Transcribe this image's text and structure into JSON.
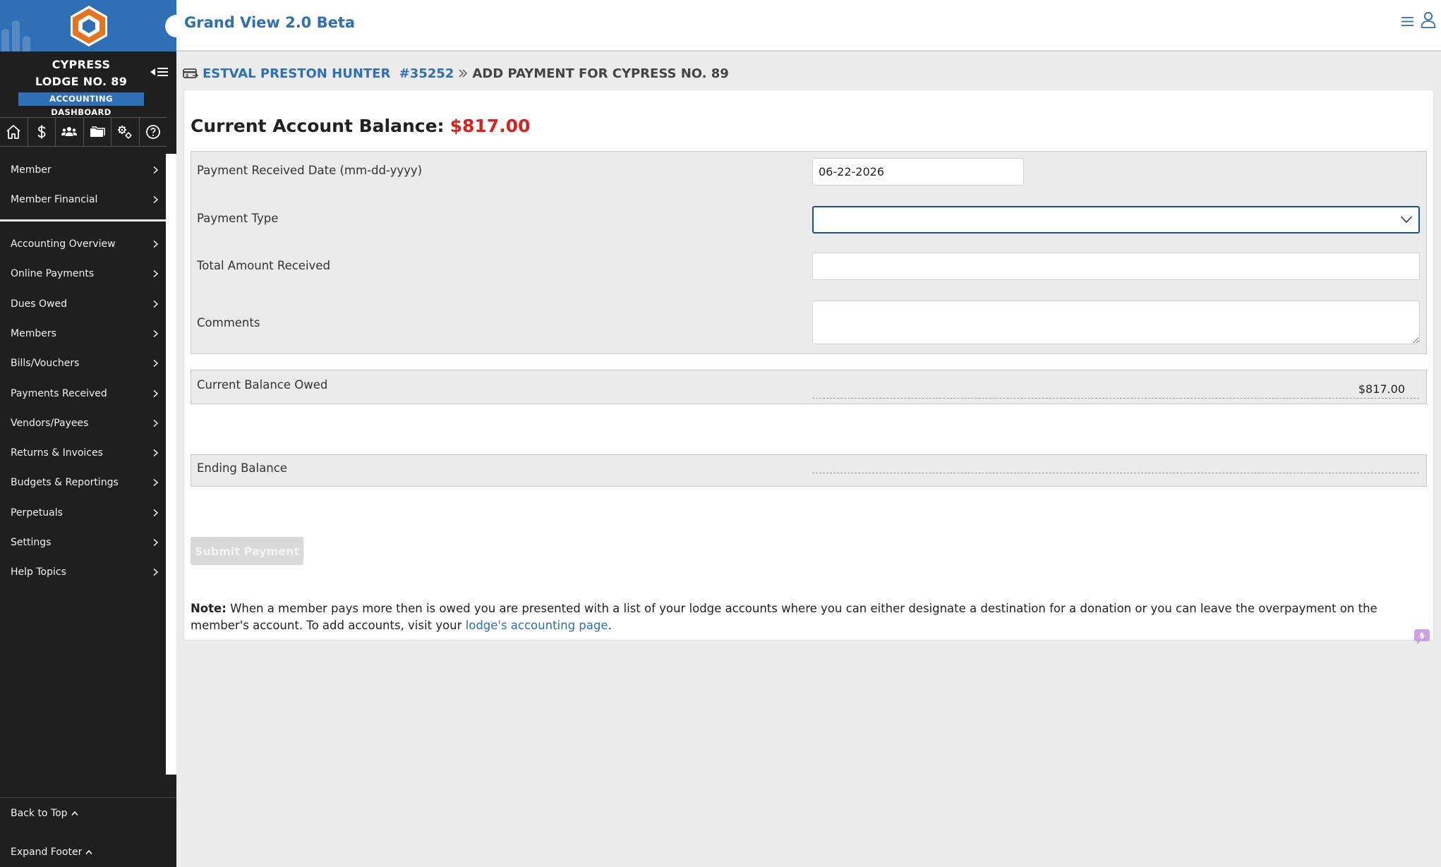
{
  "app": {
    "title": "Grand View 2.0 Beta"
  },
  "sidebar": {
    "org_line1": "CYPRESS",
    "org_line2": "LODGE NO. 89",
    "badge": "ACCOUNTING DASHBOARD",
    "icon_row": [
      "home-icon",
      "dollar-icon",
      "members-icon",
      "folder-icon",
      "settings-gears-icon",
      "help-icon"
    ],
    "primary_items": [
      {
        "label": "Member"
      },
      {
        "label": "Member Financial"
      }
    ],
    "accounting_items": [
      {
        "label": "Accounting Overview"
      },
      {
        "label": "Online Payments"
      },
      {
        "label": "Dues Owed"
      },
      {
        "label": "Members"
      },
      {
        "label": "Bills/Vouchers"
      },
      {
        "label": "Payments Received"
      },
      {
        "label": "Vendors/Payees"
      },
      {
        "label": "Returns & Invoices"
      },
      {
        "label": "Budgets & Reportings"
      },
      {
        "label": "Perpetuals"
      },
      {
        "label": "Settings"
      },
      {
        "label": "Help Topics"
      }
    ],
    "footer": {
      "back_to_top": "Back to Top",
      "expand_footer": "Expand Footer"
    }
  },
  "breadcrumb": {
    "member_name": "ESTVAL PRESTON HUNTER",
    "member_id": "#35252",
    "current": "ADD PAYMENT FOR CYPRESS NO. 89"
  },
  "balance": {
    "label": "Current Account Balance:",
    "amount": "$817.00"
  },
  "form": {
    "date_label": "Payment Received Date (mm-dd-yyyy)",
    "date_value": "06-22-2026",
    "type_label": "Payment Type",
    "type_value": "",
    "amount_label": "Total Amount Received",
    "amount_value": "",
    "comments_label": "Comments",
    "comments_value": ""
  },
  "summary": {
    "current_label": "Current Balance Owed",
    "current_value": "$817.00",
    "ending_label": "Ending Balance",
    "ending_value": ""
  },
  "actions": {
    "submit_label": "Submit Payment"
  },
  "note": {
    "prefix": "Note:",
    "text": " When a member pays more then is owed you are presented with a list of your lodge accounts where you can either designate a destination for a donation or you can leave the overpayment on the member's account. To add accounts, visit your ",
    "link_text": "lodge's accounting page",
    "suffix": "."
  },
  "colors": {
    "brand_blue": "#2f6fb5",
    "sidebar_bg": "#1f1f1f",
    "balance_red": "#d9211e",
    "logo_orange": "#e8731f",
    "select_focus": "#1d4f8c"
  }
}
